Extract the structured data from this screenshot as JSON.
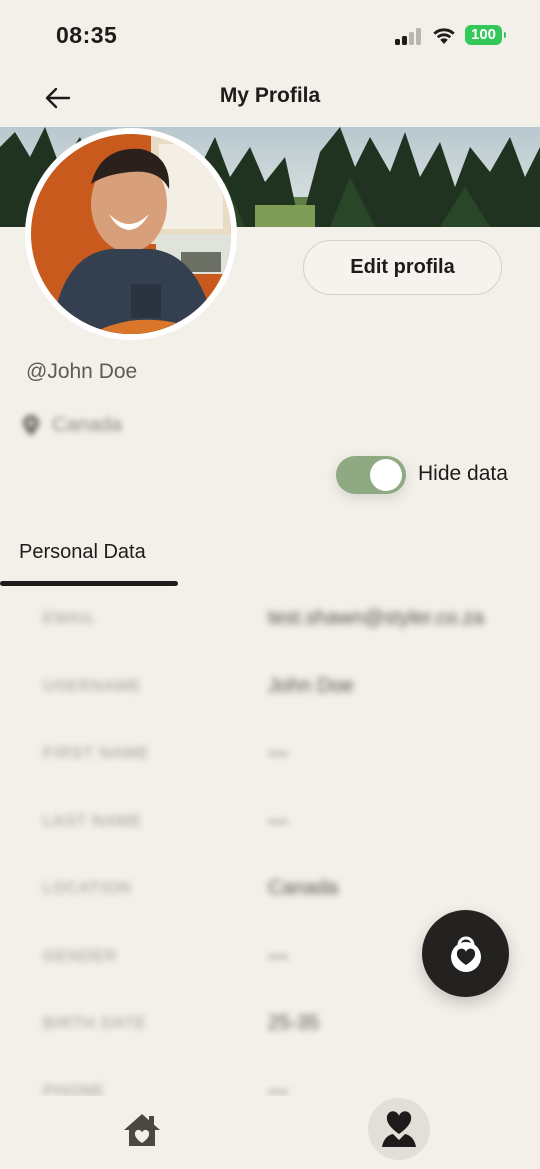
{
  "status_bar": {
    "time": "08:35",
    "battery": "100",
    "battery_color": "#34c759"
  },
  "header": {
    "title": "My Profila",
    "back_icon": "arrow-left-icon"
  },
  "profile": {
    "edit_button_label": "Edit profila",
    "handle": "@John Doe",
    "location": "Canada",
    "hide_data_label": "Hide data",
    "hide_data_on": true
  },
  "tabs": {
    "active": "Personal Data"
  },
  "personal_data": [
    {
      "label": "EMAIL",
      "value": "test.shawn@styler.co.za"
    },
    {
      "label": "USERNAME",
      "value": "John Doe"
    },
    {
      "label": "FIRST NAME",
      "value": "—"
    },
    {
      "label": "LAST NAME",
      "value": "—"
    },
    {
      "label": "LOCATION",
      "value": "Canada"
    },
    {
      "label": "GENDER",
      "value": "—"
    },
    {
      "label": "BIRTH DATE",
      "value": "25-35"
    },
    {
      "label": "PHONE",
      "value": "—"
    }
  ],
  "fab": {
    "icon": "heart-lock-icon"
  },
  "bottom_nav": {
    "home_icon": "home-heart-icon",
    "profile_icon": "person-heart-icon"
  },
  "colors": {
    "background": "#f3f0ea",
    "toggle_on": "#8fa983",
    "dark": "#242220"
  }
}
